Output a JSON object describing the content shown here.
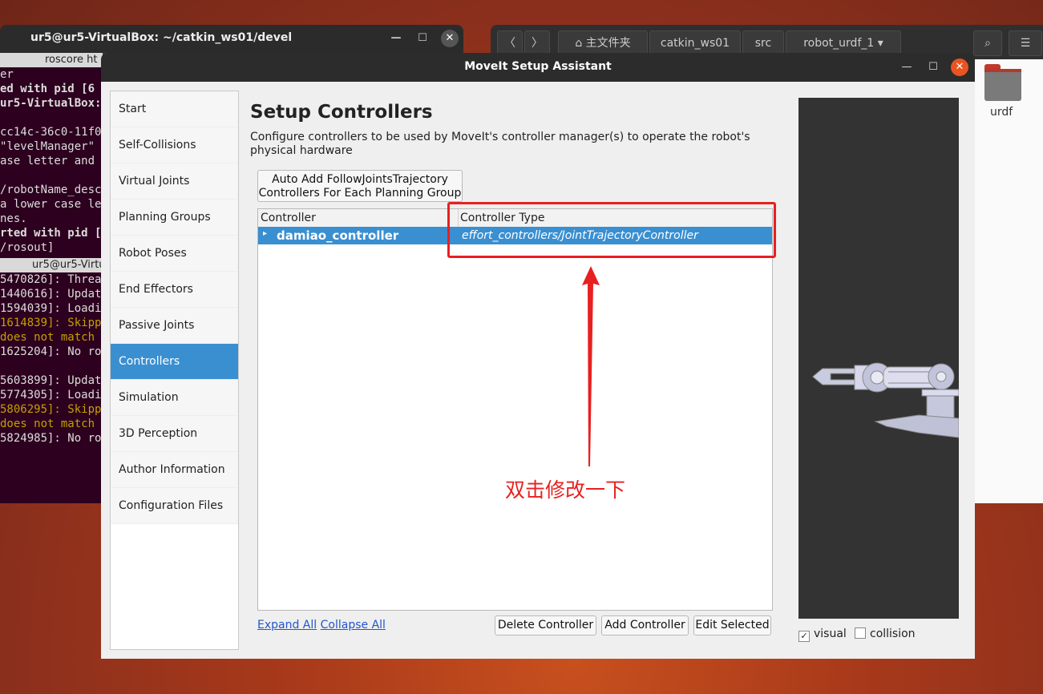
{
  "terminal": {
    "title": "ur5@ur5-VirtualBox: ~/catkin_ws01/devel",
    "tab1": "roscore ht",
    "tab2": "ur5@ur5-Virtu",
    "lines_top": [
      {
        "text": "er",
        "style": ""
      },
      {
        "text": "ed with pid [6",
        "style": "b"
      },
      {
        "text": "ur5-VirtualBox:",
        "style": "b"
      },
      {
        "text": "",
        "style": ""
      },
      {
        "text": "cc14c-36c0-11f0",
        "style": ""
      },
      {
        "text": "\"levelManager\"",
        "style": ""
      },
      {
        "text": "ase letter and",
        "style": ""
      },
      {
        "text": "",
        "style": ""
      },
      {
        "text": "/robotName_desc",
        "style": ""
      },
      {
        "text": "a lower case le",
        "style": ""
      },
      {
        "text": "nes.",
        "style": ""
      },
      {
        "text": "rted with pid [",
        "style": "b"
      },
      {
        "text": "/rosout]",
        "style": ""
      }
    ],
    "lines_bottom": [
      {
        "text": "5470826]: Threa",
        "style": ""
      },
      {
        "text": "1440616]: Updat",
        "style": ""
      },
      {
        "text": "1594039]: Loadi",
        "style": ""
      },
      {
        "text": "1614839]: Skipp",
        "style": "y"
      },
      {
        "text": "does not match",
        "style": "y"
      },
      {
        "text": "1625204]: No ro",
        "style": ""
      },
      {
        "text": "",
        "style": ""
      },
      {
        "text": "5603899]: Updat",
        "style": ""
      },
      {
        "text": "5774305]: Loadi",
        "style": ""
      },
      {
        "text": "5806295]: Skipp",
        "style": "y"
      },
      {
        "text": "does not match",
        "style": "y"
      },
      {
        "text": "5824985]: No ro",
        "style": ""
      }
    ]
  },
  "file_manager": {
    "nav_back": "〈",
    "nav_forward": "〉",
    "breadcrumb": [
      "主文件夹",
      "catkin_ws01",
      "src",
      "robot_urdf_1"
    ],
    "folder_label": "urdf"
  },
  "dialog": {
    "title": "MoveIt Setup Assistant",
    "nav_items": [
      "Start",
      "Self-Collisions",
      "Virtual Joints",
      "Planning Groups",
      "Robot Poses",
      "End Effectors",
      "Passive Joints",
      "Controllers",
      "Simulation",
      "3D Perception",
      "Author Information",
      "Configuration Files"
    ],
    "selected_nav": "Controllers",
    "heading": "Setup Controllers",
    "description": "Configure controllers to be used by MoveIt's controller manager(s) to operate the robot's physical hardware",
    "auto_add_line1": "Auto Add FollowJointsTrajectory",
    "auto_add_line2": "Controllers For Each Planning Group",
    "table": {
      "col1": "Controller",
      "col2": "Controller Type",
      "rows": [
        {
          "name": "damiao_controller",
          "type": "effort_controllers/JointTrajectoryController"
        }
      ]
    },
    "expand_all": "Expand All",
    "collapse_all": "Collapse All",
    "delete_btn": "Delete Controller",
    "add_btn": "Add Controller",
    "edit_btn": "Edit Selected",
    "visual_label": "visual",
    "visual_checked": "✓",
    "collision_label": "collision"
  },
  "annotation": "双击修改一下",
  "colors": {
    "accent": "#3a8fd1",
    "annotation": "#e82020",
    "close": "#e95420"
  }
}
